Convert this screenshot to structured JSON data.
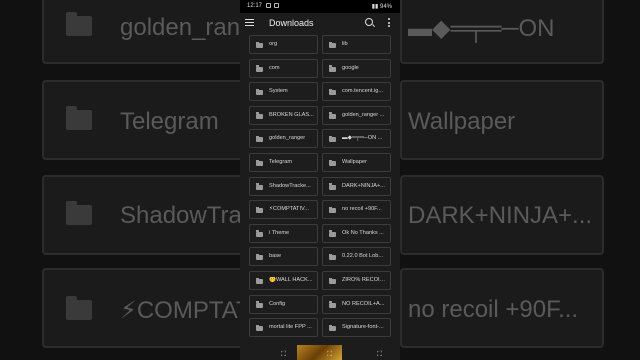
{
  "status_bar": {
    "time": "12:17",
    "battery": "94%"
  },
  "app_bar": {
    "title": "Downloads"
  },
  "folders": [
    {
      "name": "org"
    },
    {
      "name": "lib"
    },
    {
      "name": "com"
    },
    {
      "name": "google"
    },
    {
      "name": "System"
    },
    {
      "name": "com.tencent.ig..."
    },
    {
      "name": "BROKEN GLAS..."
    },
    {
      "name": "golden_ranger ..."
    },
    {
      "name": "golden_ranger"
    },
    {
      "name": "▬◆═╤═─ON ..."
    },
    {
      "name": "Telegram"
    },
    {
      "name": "Wallpaper"
    },
    {
      "name": "ShadowTracke..."
    },
    {
      "name": "DARK+NINJA+..."
    },
    {
      "name": "⚡COMPTATIV..."
    },
    {
      "name": "no recoil +90F..."
    },
    {
      "name": "i Theme"
    },
    {
      "name": "Ok No Thanks ..."
    },
    {
      "name": "base"
    },
    {
      "name": "0.22.0 Bot Lob..."
    },
    {
      "name": "🤫WALL HACK..."
    },
    {
      "name": "ZIRO% RECOIL ..."
    },
    {
      "name": "Config"
    },
    {
      "name": "NO RECOIL+A..."
    },
    {
      "name": "mortal lite FPP ..."
    },
    {
      "name": "Signature-font-..."
    }
  ],
  "background": {
    "labels": [
      "golden_range",
      "▬◆═╤═─ON",
      "Telegram",
      "Wallpaper",
      "ShadowTrac",
      "DARK+NINJA+...",
      "⚡COMPTAT",
      "no recoil +90F..."
    ]
  }
}
